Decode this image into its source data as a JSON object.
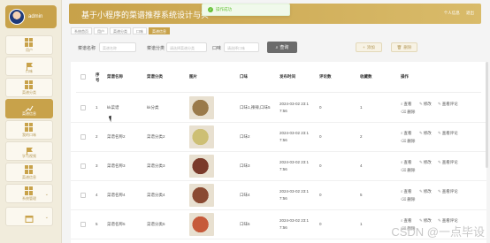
{
  "sidebar": {
    "user": "admin",
    "items": [
      {
        "label": "用户",
        "icon": "grid-icon"
      },
      {
        "label": "口味",
        "icon": "flag-icon"
      },
      {
        "label": "菜谱分类",
        "icon": "grid-icon"
      },
      {
        "label": "菜谱信息",
        "icon": "chart-icon"
      },
      {
        "label": "我的口味",
        "icon": "grid-icon"
      },
      {
        "label": "学习视频",
        "icon": "flag-icon"
      },
      {
        "label": "菜谱信息",
        "icon": "grid-icon"
      },
      {
        "label": "系统管理",
        "icon": "grid-icon"
      },
      {
        "label": "",
        "icon": "window-icon"
      }
    ]
  },
  "header": {
    "title": "基于小程序的菜谱推荐系统设计与实",
    "right": [
      "个人信息",
      "退出"
    ]
  },
  "toast": {
    "text": "操作成功"
  },
  "tabs": [
    "系统首页",
    "用户",
    "菜谱分类",
    "口味",
    "菜谱信息"
  ],
  "search": {
    "name_label": "菜谱名称",
    "name_placeholder": "菜谱名称",
    "category_label": "菜谱分类",
    "category_placeholder": "请选择菜谱分类",
    "taste_label": "口味",
    "taste_placeholder": "请选择口味",
    "search_button": "查询",
    "add_button": "添加",
    "delete_button": "删除"
  },
  "table": {
    "headers": [
      "序号",
      "菜谱名称",
      "菜谱分类",
      "图片",
      "口味",
      "发布时间",
      "评论数",
      "收藏数",
      "操作"
    ],
    "rows": [
      {
        "index": "1",
        "name": "kk菜谱",
        "category": "kk分类",
        "taste": "口味1,辣辣,口味5",
        "time1": "2024-03-02 23:1",
        "time2": "7:56",
        "comments": "0",
        "favorites": "1",
        "img": "#9a7a4a"
      },
      {
        "index": "2",
        "name": "菜谱名称2",
        "category": "菜谱分类2",
        "taste": "口味2",
        "time1": "2024-03-02 23:1",
        "time2": "7:56",
        "comments": "0",
        "favorites": "2",
        "img": "#cdbf74"
      },
      {
        "index": "3",
        "name": "菜谱名称3",
        "category": "菜谱分类3",
        "taste": "口味3",
        "time1": "2024-03-02 23:1",
        "time2": "7:56",
        "comments": "0",
        "favorites": "4",
        "img": "#7a3a2a"
      },
      {
        "index": "4",
        "name": "菜谱名称4",
        "category": "菜谱分类4",
        "taste": "口味4",
        "time1": "2024-03-02 23:1",
        "time2": "7:56",
        "comments": "0",
        "favorites": "5",
        "img": "#8a4a32"
      },
      {
        "index": "5",
        "name": "菜谱名称5",
        "category": "菜谱分类5",
        "taste": "口味5",
        "time1": "2024-03-02 23:1",
        "time2": "7:56",
        "comments": "0",
        "favorites": "1",
        "img": "#c65a3a"
      }
    ],
    "actions": {
      "view": "查看",
      "edit": "修改",
      "view_comments": "查看评论",
      "delete": "删除"
    }
  },
  "watermark": "CSDN @一点毕设",
  "colors": {
    "accent": "#c8a24a"
  }
}
